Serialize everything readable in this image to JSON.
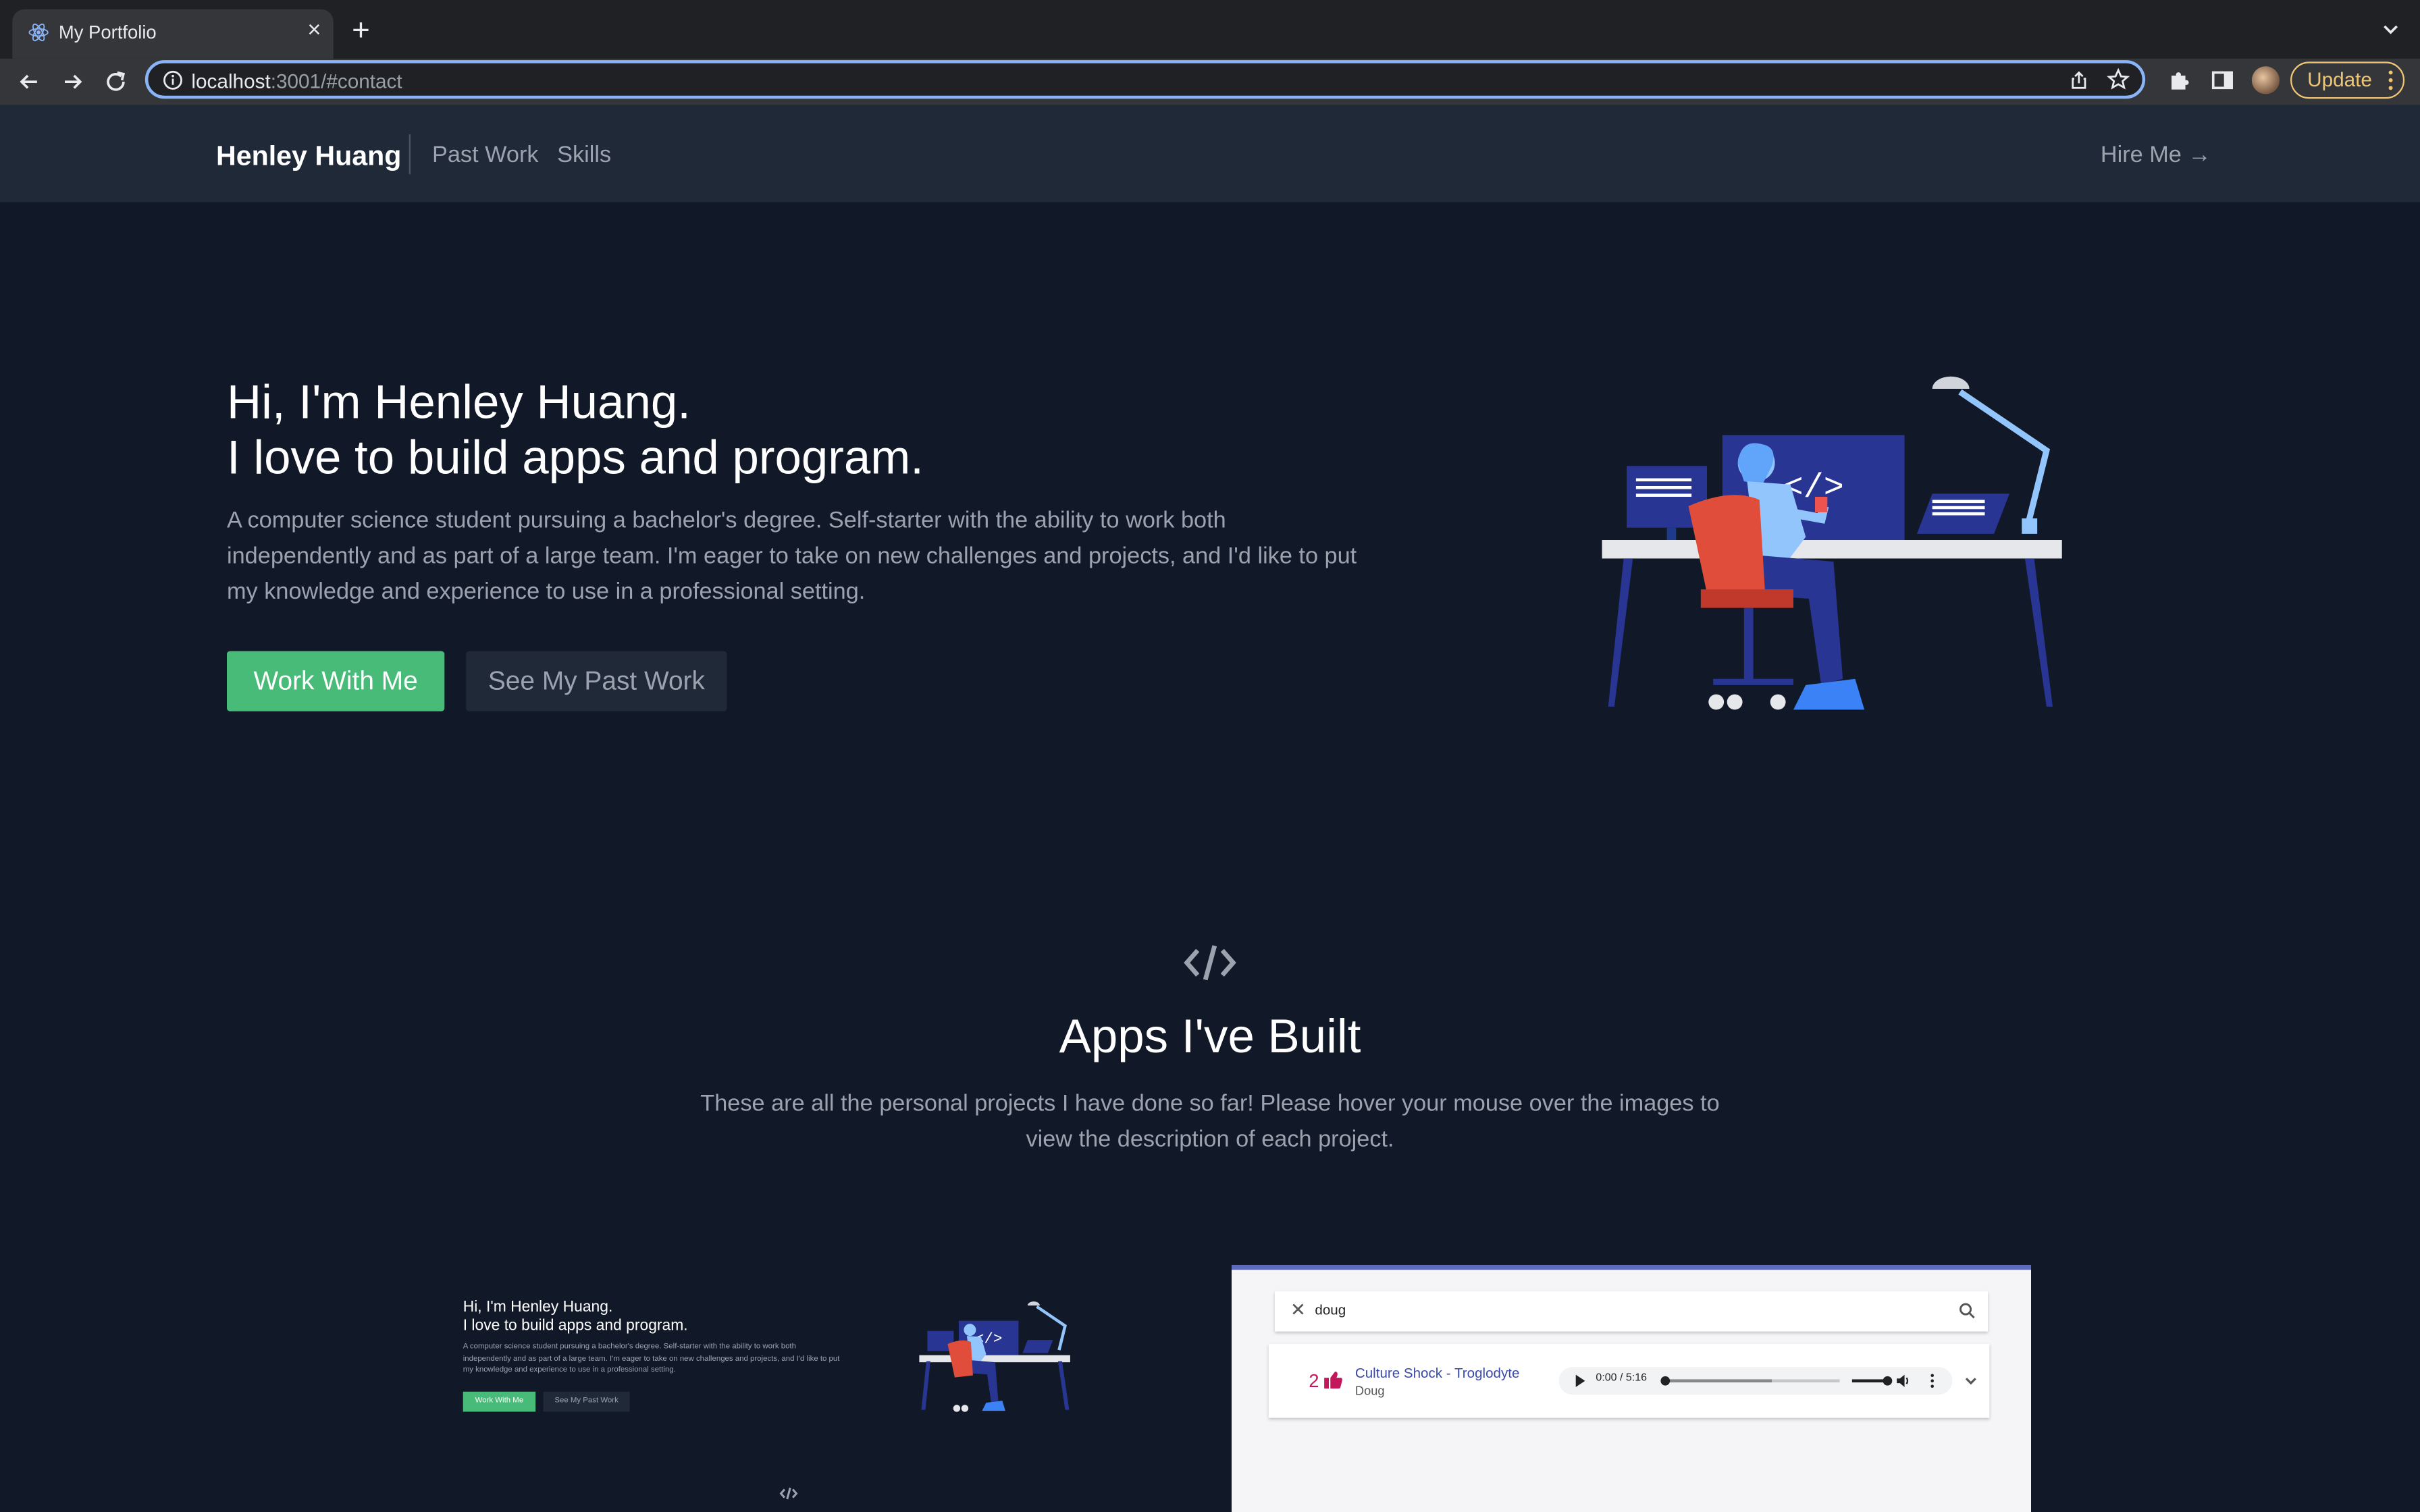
{
  "browser": {
    "tab_title": "My Portfolio",
    "new_tab": "+",
    "url_host": "localhost",
    "url_rest": ":3001/#contact",
    "update_label": "Update"
  },
  "nav": {
    "brand": "Henley Huang",
    "links": [
      "Past Work",
      "Skills"
    ],
    "hire_me": "Hire Me →"
  },
  "hero": {
    "title_line1": "Hi, I'm Henley Huang.",
    "title_line2": "I love to build apps and program.",
    "description": "A computer science student pursuing a bachelor's degree. Self-starter with the ability to work both independently and as part of a large team. I'm eager to take on new challenges and projects, and I'd like to put my knowledge and experience to use in a professional setting.",
    "primary_button": "Work With Me",
    "secondary_button": "See My Past Work"
  },
  "apps": {
    "title": "Apps I've Built",
    "description": "These are all the personal projects I have done so far! Please hover your mouse over the images to view the description of each project.",
    "projects": [
      {
        "title_line1": "Hi, I'm Henley Huang.",
        "title_line2": "I love to build apps and program.",
        "description": "A computer science student pursuing a bachelor's degree. Self-starter with the ability to work both independently and as part of a large team. I'm eager to take on new challenges and projects, and I'd like to put my knowledge and experience to use in a professional setting.",
        "primary_button": "Work With Me",
        "secondary_button": "See My Past Work"
      },
      {
        "search_query": "doug",
        "likes": "2",
        "song": "Culture Shock - Troglodyte",
        "artist": "Doug",
        "time": "0:00 / 5:16"
      }
    ]
  },
  "colors": {
    "page_bg": "#111827",
    "nav_bg": "#1f2937",
    "accent_green": "#48bb78",
    "muted_text": "#9ca3af"
  }
}
